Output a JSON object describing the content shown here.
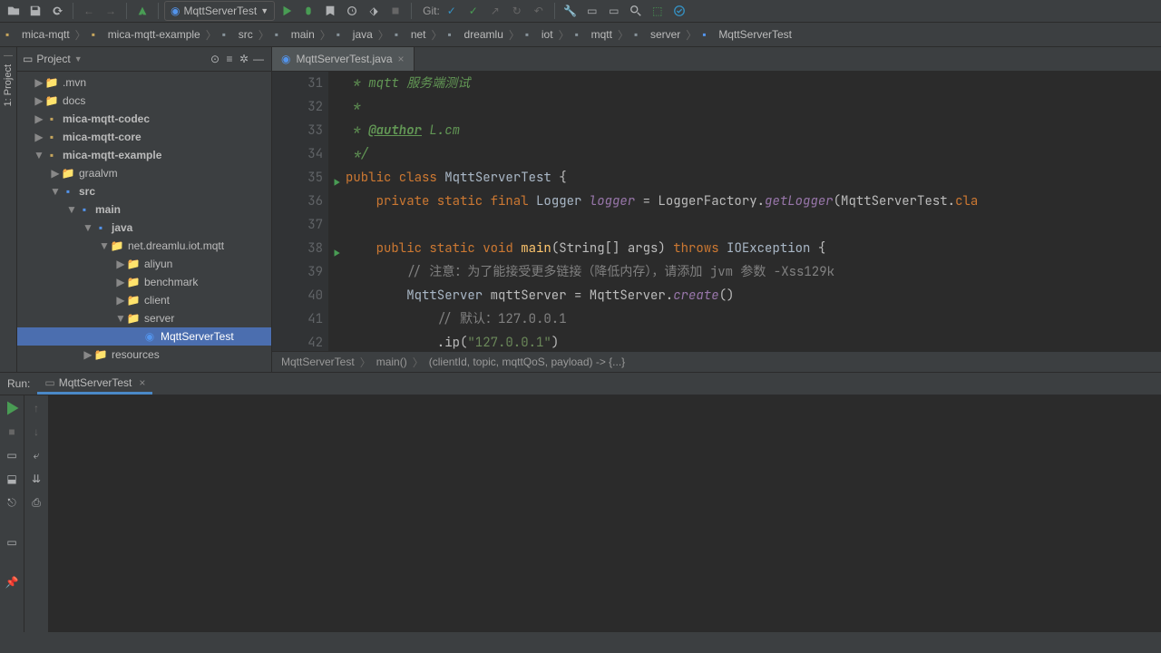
{
  "toolbar": {
    "run_config": "MqttServerTest",
    "git_label": "Git:"
  },
  "breadcrumbs": [
    "mica-mqtt",
    "mica-mqtt-example",
    "src",
    "main",
    "java",
    "net",
    "dreamlu",
    "iot",
    "mqtt",
    "server",
    "MqttServerTest"
  ],
  "project": {
    "title": "Project",
    "tree": [
      {
        "d": 0,
        "a": "▶",
        "i": "fold",
        "t": ".mvn"
      },
      {
        "d": 0,
        "a": "▶",
        "i": "fold",
        "t": "docs"
      },
      {
        "d": 0,
        "a": "▶",
        "i": "mod",
        "t": "mica-mqtt-codec"
      },
      {
        "d": 0,
        "a": "▶",
        "i": "mod",
        "t": "mica-mqtt-core"
      },
      {
        "d": 0,
        "a": "▼",
        "i": "mod",
        "t": "mica-mqtt-example"
      },
      {
        "d": 1,
        "a": "▶",
        "i": "fold",
        "t": "graalvm"
      },
      {
        "d": 1,
        "a": "▼",
        "i": "src",
        "t": "src"
      },
      {
        "d": 2,
        "a": "▼",
        "i": "src",
        "t": "main"
      },
      {
        "d": 3,
        "a": "▼",
        "i": "src",
        "t": "java"
      },
      {
        "d": 4,
        "a": "▼",
        "i": "fold",
        "t": "net.dreamlu.iot.mqtt"
      },
      {
        "d": 5,
        "a": "▶",
        "i": "fold",
        "t": "aliyun"
      },
      {
        "d": 5,
        "a": "▶",
        "i": "fold",
        "t": "benchmark"
      },
      {
        "d": 5,
        "a": "▶",
        "i": "fold",
        "t": "client"
      },
      {
        "d": 5,
        "a": "▼",
        "i": "fold",
        "t": "server"
      },
      {
        "d": 6,
        "a": "",
        "i": "cls",
        "t": "MqttServerTest",
        "sel": true
      },
      {
        "d": 3,
        "a": "▶",
        "i": "fold",
        "t": "resources"
      }
    ]
  },
  "sidetab": "1: Project",
  "editor": {
    "tab": "MqttServerTest.java",
    "lines": [
      {
        "n": 31,
        "html": "<span class='doc'> * mqtt 服务端测试</span>"
      },
      {
        "n": 32,
        "html": "<span class='doc'> *</span>"
      },
      {
        "n": 33,
        "html": "<span class='doc'> * <span class='tag'>@author</span> L.cm</span>"
      },
      {
        "n": 34,
        "html": "<span class='doc'> */</span>"
      },
      {
        "n": 35,
        "g": true,
        "html": "<span class='kw'>public class</span> <span class='cname'>MqttServerTest</span> {"
      },
      {
        "n": 36,
        "html": "    <span class='kw'>private static final</span> <span class='cname'>Logger</span> <span class='stat'>logger</span> = LoggerFactory.<span class='stat'>getLogger</span>(MqttServerTest.<span class='kw'>cla</span>"
      },
      {
        "n": 37,
        "html": ""
      },
      {
        "n": 38,
        "g": true,
        "html": "    <span class='kw'>public static void</span> <span class='fn'>main</span>(String[] args) <span class='kw'>throws</span> <span class='cname'>IOException</span> {"
      },
      {
        "n": 39,
        "html": "        <span class='cmt'>// 注意：为了能接受更多链接（降低内存），请添加 jvm 参数 -Xss129k</span>"
      },
      {
        "n": 40,
        "html": "        <span class='cname'>MqttServer</span> mqttServer = MqttServer.<span class='stat'>create</span>()"
      },
      {
        "n": 41,
        "html": "            <span class='cmt'>// 默认：127.0.0.1</span>"
      },
      {
        "n": 42,
        "html": "            .ip(<span class='str'>\"127.0.0.1\"</span>)"
      }
    ],
    "crumbs": [
      "MqttServerTest",
      "main()",
      "(clientId, topic, mqttQoS, payload) -> {...}"
    ]
  },
  "run": {
    "label": "Run:",
    "tab": "MqttServerTest"
  }
}
